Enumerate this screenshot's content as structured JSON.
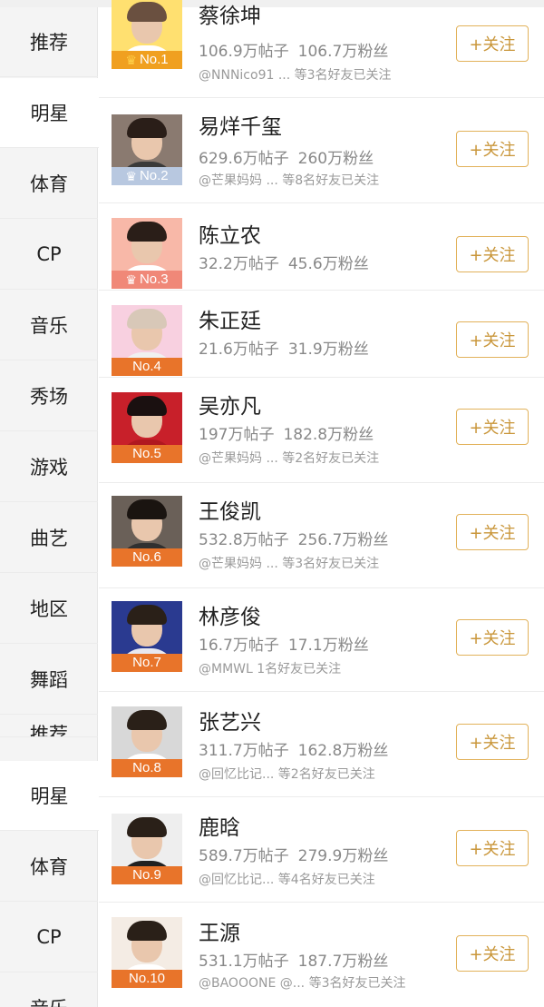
{
  "sidebar": {
    "items": [
      {
        "label": "推荐"
      },
      {
        "label": "明星"
      },
      {
        "label": "体育"
      },
      {
        "label": "CP"
      },
      {
        "label": "音乐"
      },
      {
        "label": "秀场"
      },
      {
        "label": "游戏"
      },
      {
        "label": "曲艺"
      },
      {
        "label": "地区"
      },
      {
        "label": "舞蹈"
      },
      {
        "label": "推荐"
      },
      {
        "label": "明星"
      },
      {
        "label": "体育"
      },
      {
        "label": "CP"
      },
      {
        "label": "音乐"
      }
    ]
  },
  "list": {
    "rows": [
      {
        "rank": "No.1",
        "crown": "gold",
        "name": "蔡徐坤",
        "posts": "106.9万帖子",
        "fans": "106.7万粉丝",
        "friends": "@NNNico91 ... 等3名好友已关注",
        "follow_label": "+关注",
        "rank_color": "#f0a020",
        "avatar_bg": "#ffe070",
        "avatar_body": "#ffffff",
        "avatar_hair": "#6a5040"
      },
      {
        "rank": "No.2",
        "crown": "silver",
        "name": "易烊千玺",
        "posts": "629.6万帖子",
        "fans": "260万粉丝",
        "friends": "@芒果妈妈 ... 等8名好友已关注",
        "follow_label": "+关注",
        "rank_color": "#b8c8e0",
        "avatar_bg": "#8a7a70",
        "avatar_body": "#3a3a3a",
        "avatar_hair": "#2a1e18"
      },
      {
        "rank": "No.3",
        "crown": "bronze",
        "name": "陈立农",
        "posts": "32.2万帖子",
        "fans": "45.6万粉丝",
        "friends": "",
        "follow_label": "+关注",
        "rank_color": "#f08878",
        "avatar_bg": "#f8b8a8",
        "avatar_body": "#ffffff",
        "avatar_hair": "#2a1e18"
      },
      {
        "rank": "No.4",
        "crown": "",
        "name": "朱正廷",
        "posts": "21.6万帖子",
        "fans": "31.9万粉丝",
        "friends": "",
        "follow_label": "+关注",
        "rank_color": "#e8742a",
        "avatar_bg": "#f8d0e0",
        "avatar_body": "#f0f0f0",
        "avatar_hair": "#d8c8b8"
      },
      {
        "rank": "No.5",
        "crown": "",
        "name": "吴亦凡",
        "posts": "197万帖子",
        "fans": "182.8万粉丝",
        "friends": "@芒果妈妈 ... 等2名好友已关注",
        "follow_label": "+关注",
        "rank_color": "#e8742a",
        "avatar_bg": "#c8202a",
        "avatar_body": "#b01820",
        "avatar_hair": "#1a1010"
      },
      {
        "rank": "No.6",
        "crown": "",
        "name": "王俊凯",
        "posts": "532.8万帖子",
        "fans": "256.7万粉丝",
        "friends": "@芒果妈妈 ... 等3名好友已关注",
        "follow_label": "+关注",
        "rank_color": "#e8742a",
        "avatar_bg": "#6a6058",
        "avatar_body": "#303030",
        "avatar_hair": "#1a1410"
      },
      {
        "rank": "No.7",
        "crown": "",
        "name": "林彦俊",
        "posts": "16.7万帖子",
        "fans": "17.1万粉丝",
        "friends": "@MMWL 1名好友已关注",
        "follow_label": "+关注",
        "rank_color": "#e8742a",
        "avatar_bg": "#2a3a90",
        "avatar_body": "#e8e8f0",
        "avatar_hair": "#2a2018"
      },
      {
        "rank": "No.8",
        "crown": "",
        "name": "张艺兴",
        "posts": "311.7万帖子",
        "fans": "162.8万粉丝",
        "friends": "@回忆比记... 等2名好友已关注",
        "follow_label": "+关注",
        "rank_color": "#e8742a",
        "avatar_bg": "#d8d8d8",
        "avatar_body": "#ffffff",
        "avatar_hair": "#2a2018"
      },
      {
        "rank": "No.9",
        "crown": "",
        "name": "鹿晗",
        "posts": "589.7万帖子",
        "fans": "279.9万粉丝",
        "friends": "@回忆比记... 等4名好友已关注",
        "follow_label": "+关注",
        "rank_color": "#e8742a",
        "avatar_bg": "#eeeeee",
        "avatar_body": "#202020",
        "avatar_hair": "#2a2018"
      },
      {
        "rank": "No.10",
        "crown": "",
        "name": "王源",
        "posts": "531.1万帖子",
        "fans": "187.7万粉丝",
        "friends": "@BAOOONE @... 等3名好友已关注",
        "follow_label": "+关注",
        "rank_color": "#e8742a",
        "avatar_bg": "#f4ece4",
        "avatar_body": "#ffffff",
        "avatar_hair": "#2a2018"
      }
    ]
  },
  "colors": {
    "accent": "#c9963a",
    "rank_badge": "#e8742a",
    "sidebar_bg": "#f4f4f4"
  }
}
